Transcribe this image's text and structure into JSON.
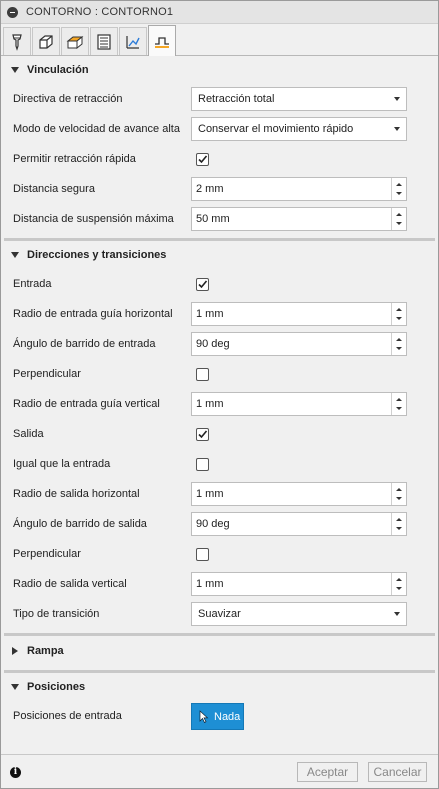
{
  "window": {
    "title": "CONTORNO : CONTORNO1"
  },
  "tabs": [
    {
      "icon": "tool-icon"
    },
    {
      "icon": "geometry-icon"
    },
    {
      "icon": "heights-icon"
    },
    {
      "icon": "passes-icon"
    },
    {
      "icon": "linking-icon"
    },
    {
      "icon": "linking-transitions-icon",
      "active": true
    }
  ],
  "vinculacion": {
    "title": "Vinculación",
    "retract_policy": {
      "label": "Directiva de retracción",
      "value": "Retracción total"
    },
    "high_feed_mode": {
      "label": "Modo de velocidad de avance alta",
      "value": "Conservar el movimiento rápido"
    },
    "allow_rapid_retract": {
      "label": "Permitir retracción rápida",
      "checked": true
    },
    "safe_distance": {
      "label": "Distancia segura",
      "value": "2 mm"
    },
    "max_stay_down": {
      "label": "Distancia de suspensión máxima",
      "value": "50 mm"
    }
  },
  "direcciones": {
    "title": "Direcciones y transiciones",
    "lead_in": {
      "label": "Entrada",
      "checked": true
    },
    "lead_in_h_radius": {
      "label": "Radio de entrada guía horizontal",
      "value": "1 mm"
    },
    "lead_in_sweep": {
      "label": "Ángulo de barrido de entrada",
      "value": "90 deg"
    },
    "lead_in_perp": {
      "label": "Perpendicular",
      "checked": false
    },
    "lead_in_v_radius": {
      "label": "Radio de entrada guía vertical",
      "value": "1 mm"
    },
    "lead_out": {
      "label": "Salida",
      "checked": true
    },
    "same_as_lead_in": {
      "label": "Igual que la entrada",
      "checked": false
    },
    "lead_out_h_radius": {
      "label": "Radio de salida horizontal",
      "value": "1 mm"
    },
    "lead_out_sweep": {
      "label": "Ángulo de barrido de salida",
      "value": "90 deg"
    },
    "lead_out_perp": {
      "label": "Perpendicular",
      "checked": false
    },
    "lead_out_v_radius": {
      "label": "Radio de salida vertical",
      "value": "1 mm"
    },
    "transition_type": {
      "label": "Tipo de transición",
      "value": "Suavizar"
    }
  },
  "rampa": {
    "title": "Rampa"
  },
  "posiciones": {
    "title": "Posiciones",
    "entry_positions": {
      "label": "Posiciones de entrada",
      "button": "Nada"
    }
  },
  "footer": {
    "ok": "Aceptar",
    "cancel": "Cancelar",
    "info_glyph": "i"
  }
}
